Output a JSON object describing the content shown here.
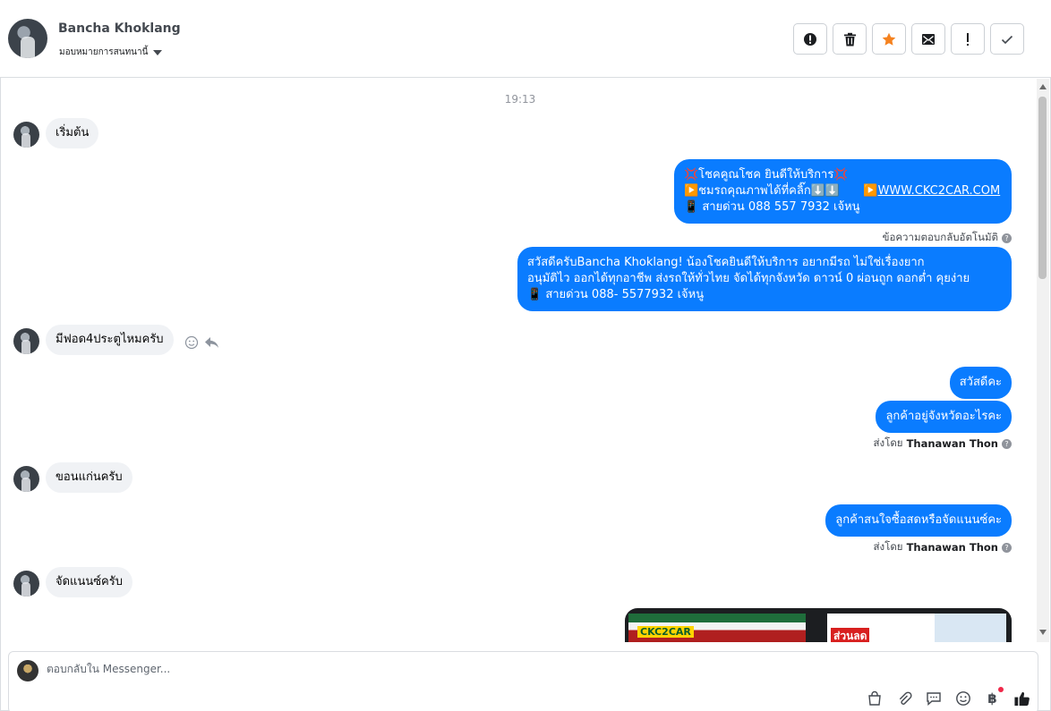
{
  "header": {
    "name": "Bancha Khoklang",
    "assign_label": "มอบหมายการสนทนานี้",
    "toolbar": [
      {
        "name": "mark-spam-button",
        "icon": "alert-circle-icon",
        "glyph": "⬤"
      },
      {
        "name": "delete-button",
        "icon": "trash-icon",
        "glyph": "🗑"
      },
      {
        "name": "star-button",
        "icon": "star-icon",
        "glyph": "★"
      },
      {
        "name": "mark-unread-button",
        "icon": "envelope-icon",
        "glyph": "✉"
      },
      {
        "name": "follow-up-button",
        "icon": "exclamation-icon",
        "glyph": "!"
      },
      {
        "name": "mark-done-button",
        "icon": "check-icon",
        "glyph": "✓"
      }
    ]
  },
  "thread": {
    "timestamp": "19:13",
    "messages": [
      {
        "dir": "in",
        "text": "เริ่มต้น"
      },
      {
        "dir": "out",
        "lines": [
          "💢โชคคูณโชค ยินดีให้บริการ💢",
          "▶️ชมรถคุณภาพได้ที่คลิ๊ก⬇️⬇️",
          "📱 สายด่วน 088 557 7932 เจ้หนู"
        ],
        "link": "WWW.CKC2CAR.COM",
        "link_prefix": "▶️"
      },
      {
        "dir": "meta",
        "text": "ข้อความตอบกลับอัตโนมัติ"
      },
      {
        "dir": "out",
        "lines": [
          "สวัสดีครับBancha Khoklang! น้องโชคยินดีให้บริการ อยากมีรถ ไม่ใช่เรื่องยาก",
          "อนุมัติไว ออกได้ทุกอาชีพ ส่งรถให้ทั่วไทย จัดได้ทุกจังหวัด ดาวน์ 0  ผ่อนถูก ดอกต่ำ คุยง่าย",
          "📱 สายด่วน 088- 5577932 เจ้หนู"
        ]
      },
      {
        "dir": "in",
        "text": "มีฟอด4ประตูไหมครับ"
      },
      {
        "dir": "out",
        "text": "สวัสดีคะ"
      },
      {
        "dir": "out",
        "text": "ลูกค้าอยู่จังหวัดอะไรคะ"
      },
      {
        "dir": "meta",
        "prefix": "ส่งโดย",
        "sender": "Thanawan Thon"
      },
      {
        "dir": "in",
        "text": "ขอนแก่นครับ"
      },
      {
        "dir": "out",
        "text": "ลูกค้าสนใจซื้อสดหรือจัดแนนซ์คะ"
      },
      {
        "dir": "meta",
        "prefix": "ส่งโดย",
        "sender": "Thanawan Thon"
      },
      {
        "dir": "in",
        "text": "จัดแนนซ์ครับ"
      }
    ],
    "image_labels": [
      "CKC2CAR",
      "ส่วนลด"
    ]
  },
  "composer": {
    "placeholder": "ตอบกลับใน Messenger...",
    "tools": [
      "shop-icon",
      "attachment-icon",
      "saved-reply-icon",
      "emoji-icon",
      "payment-icon",
      "thumbs-up-icon"
    ],
    "payment_glyph": "฿"
  },
  "help_glyph": "?"
}
